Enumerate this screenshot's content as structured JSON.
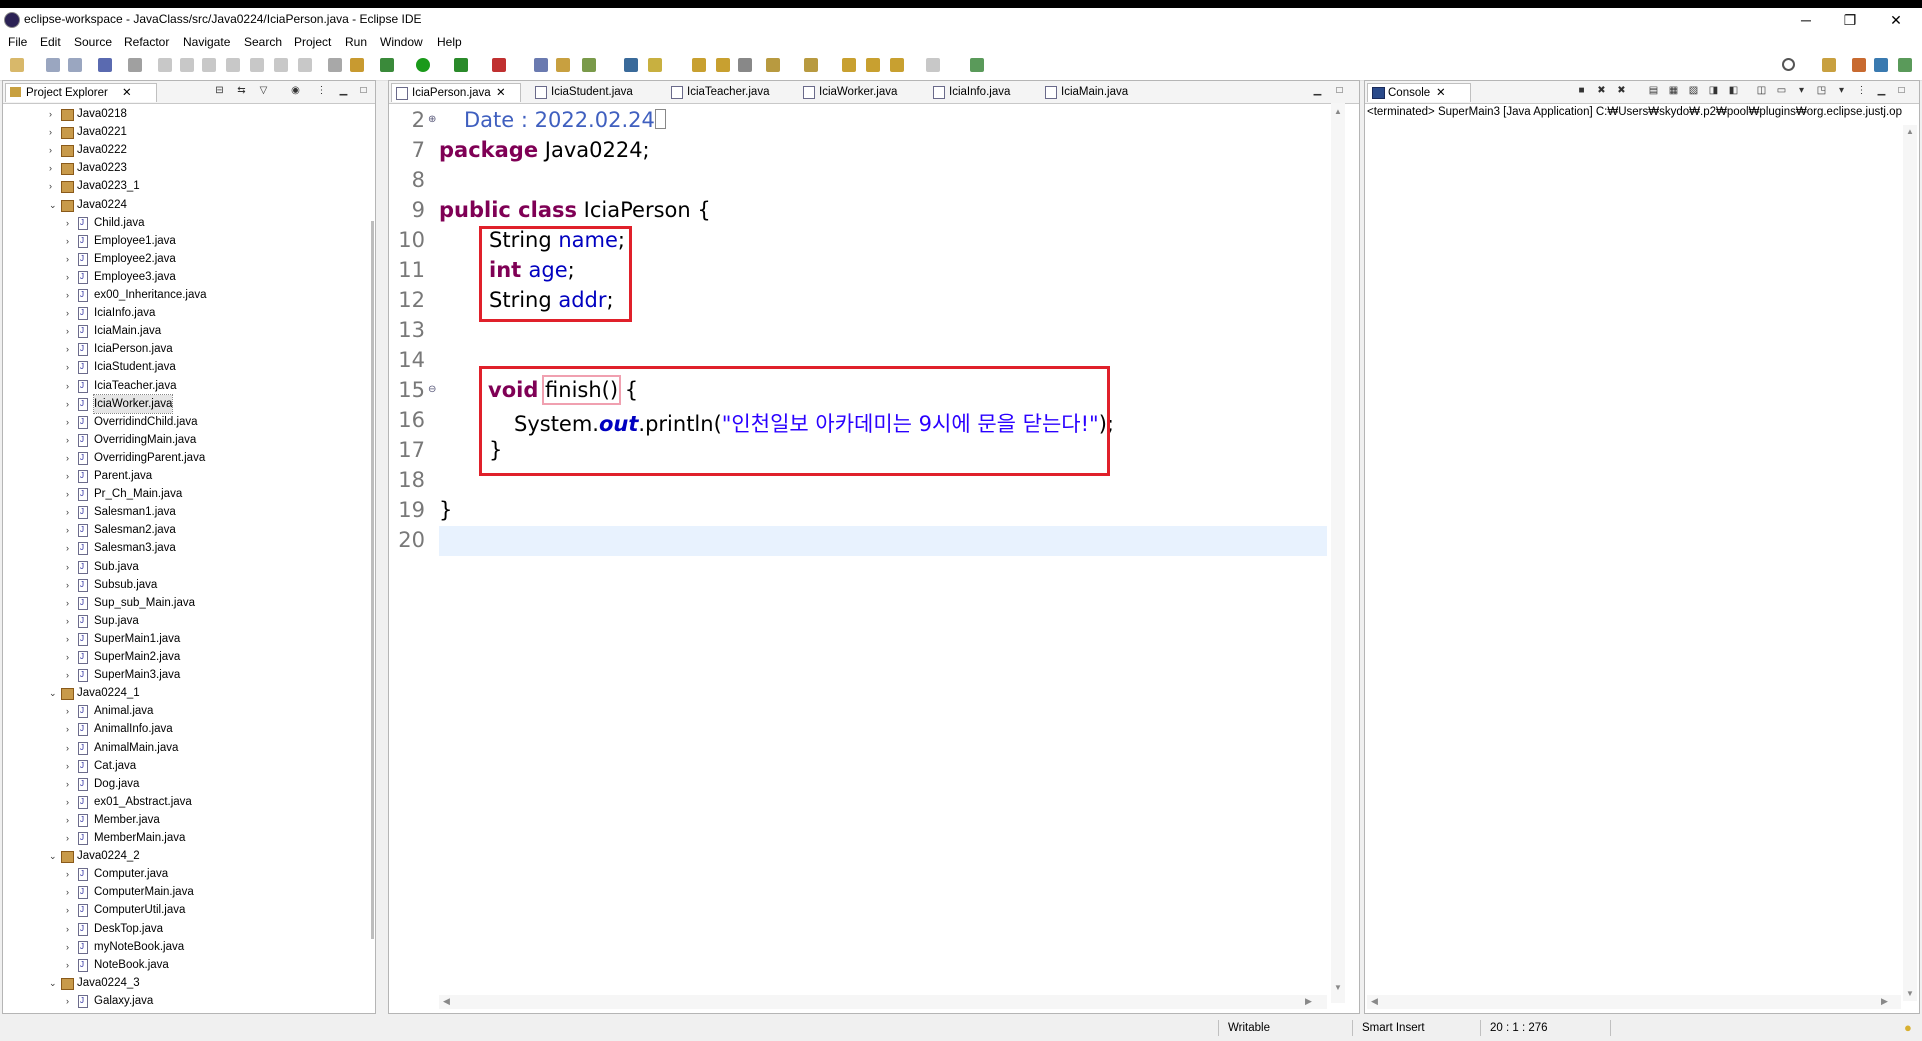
{
  "window": {
    "title": "eclipse-workspace - JavaClass/src/Java0224/IciaPerson.java - Eclipse IDE",
    "minimize": "─",
    "maximize": "❐",
    "close": "✕"
  },
  "menu": [
    "File",
    "Edit",
    "Source",
    "Refactor",
    "Navigate",
    "Search",
    "Project",
    "Run",
    "Window",
    "Help"
  ],
  "project_explorer": {
    "title": "Project Explorer",
    "items": [
      {
        "label": "Java0218",
        "type": "pkg",
        "arrow": "›",
        "indent": 0
      },
      {
        "label": "Java0221",
        "type": "pkg",
        "arrow": "›",
        "indent": 0
      },
      {
        "label": "Java0222",
        "type": "pkg",
        "arrow": "›",
        "indent": 0
      },
      {
        "label": "Java0223",
        "type": "pkg",
        "arrow": "›",
        "indent": 0
      },
      {
        "label": "Java0223_1",
        "type": "pkg",
        "arrow": "›",
        "indent": 0
      },
      {
        "label": "Java0224",
        "type": "pkg",
        "arrow": "⌄",
        "indent": 0
      },
      {
        "label": "Child.java",
        "type": "file",
        "arrow": "›",
        "indent": 1
      },
      {
        "label": "Employee1.java",
        "type": "file",
        "arrow": "›",
        "indent": 1
      },
      {
        "label": "Employee2.java",
        "type": "file",
        "arrow": "›",
        "indent": 1
      },
      {
        "label": "Employee3.java",
        "type": "file",
        "arrow": "›",
        "indent": 1
      },
      {
        "label": "ex00_Inheritance.java",
        "type": "file",
        "arrow": "›",
        "indent": 1
      },
      {
        "label": "IciaInfo.java",
        "type": "file",
        "arrow": "›",
        "indent": 1
      },
      {
        "label": "IciaMain.java",
        "type": "file",
        "arrow": "›",
        "indent": 1
      },
      {
        "label": "IciaPerson.java",
        "type": "file",
        "arrow": "›",
        "indent": 1
      },
      {
        "label": "IciaStudent.java",
        "type": "file",
        "arrow": "›",
        "indent": 1
      },
      {
        "label": "IciaTeacher.java",
        "type": "file",
        "arrow": "›",
        "indent": 1
      },
      {
        "label": "IciaWorker.java",
        "type": "file",
        "arrow": "›",
        "indent": 1,
        "selected": true
      },
      {
        "label": "OverridindChild.java",
        "type": "file",
        "arrow": "›",
        "indent": 1
      },
      {
        "label": "OverridingMain.java",
        "type": "file",
        "arrow": "›",
        "indent": 1
      },
      {
        "label": "OverridingParent.java",
        "type": "file",
        "arrow": "›",
        "indent": 1
      },
      {
        "label": "Parent.java",
        "type": "file",
        "arrow": "›",
        "indent": 1
      },
      {
        "label": "Pr_Ch_Main.java",
        "type": "file",
        "arrow": "›",
        "indent": 1
      },
      {
        "label": "Salesman1.java",
        "type": "file",
        "arrow": "›",
        "indent": 1
      },
      {
        "label": "Salesman2.java",
        "type": "file",
        "arrow": "›",
        "indent": 1
      },
      {
        "label": "Salesman3.java",
        "type": "file",
        "arrow": "›",
        "indent": 1
      },
      {
        "label": "Sub.java",
        "type": "file",
        "arrow": "›",
        "indent": 1
      },
      {
        "label": "Subsub.java",
        "type": "file",
        "arrow": "›",
        "indent": 1
      },
      {
        "label": "Sup_sub_Main.java",
        "type": "file",
        "arrow": "›",
        "indent": 1
      },
      {
        "label": "Sup.java",
        "type": "file",
        "arrow": "›",
        "indent": 1
      },
      {
        "label": "SuperMain1.java",
        "type": "file",
        "arrow": "›",
        "indent": 1
      },
      {
        "label": "SuperMain2.java",
        "type": "file",
        "arrow": "›",
        "indent": 1
      },
      {
        "label": "SuperMain3.java",
        "type": "file",
        "arrow": "›",
        "indent": 1
      },
      {
        "label": "Java0224_1",
        "type": "pkg",
        "arrow": "⌄",
        "indent": 0
      },
      {
        "label": "Animal.java",
        "type": "file",
        "arrow": "›",
        "indent": 1
      },
      {
        "label": "AnimalInfo.java",
        "type": "file",
        "arrow": "›",
        "indent": 1
      },
      {
        "label": "AnimalMain.java",
        "type": "file",
        "arrow": "›",
        "indent": 1
      },
      {
        "label": "Cat.java",
        "type": "file",
        "arrow": "›",
        "indent": 1
      },
      {
        "label": "Dog.java",
        "type": "file",
        "arrow": "›",
        "indent": 1
      },
      {
        "label": "ex01_Abstract.java",
        "type": "file",
        "arrow": "›",
        "indent": 1
      },
      {
        "label": "Member.java",
        "type": "file",
        "arrow": "›",
        "indent": 1
      },
      {
        "label": "MemberMain.java",
        "type": "file",
        "arrow": "›",
        "indent": 1
      },
      {
        "label": "Java0224_2",
        "type": "pkg",
        "arrow": "⌄",
        "indent": 0
      },
      {
        "label": "Computer.java",
        "type": "file",
        "arrow": "›",
        "indent": 1
      },
      {
        "label": "ComputerMain.java",
        "type": "file",
        "arrow": "›",
        "indent": 1
      },
      {
        "label": "ComputerUtil.java",
        "type": "file",
        "arrow": "›",
        "indent": 1
      },
      {
        "label": "DeskTop.java",
        "type": "file",
        "arrow": "›",
        "indent": 1
      },
      {
        "label": "myNoteBook.java",
        "type": "file",
        "arrow": "›",
        "indent": 1
      },
      {
        "label": "NoteBook.java",
        "type": "file",
        "arrow": "›",
        "indent": 1
      },
      {
        "label": "Java0224_3",
        "type": "pkg",
        "arrow": "⌄",
        "indent": 0
      },
      {
        "label": "Galaxy.java",
        "type": "file",
        "arrow": "›",
        "indent": 1
      }
    ]
  },
  "editor": {
    "tabs": [
      "IciaPerson.java",
      "IciaStudent.java",
      "IciaTeacher.java",
      "IciaWorker.java",
      "IciaInfo.java",
      "IciaMain.java"
    ],
    "active_tab": "IciaPerson.java",
    "line_numbers": [
      "2",
      "7",
      "8",
      "9",
      "10",
      "11",
      "12",
      "13",
      "14",
      "15",
      "16",
      "17",
      "18",
      "19",
      "20"
    ],
    "code": {
      "l2": "Date : 2022.02.24",
      "l7_kw": "package",
      "l7_rest": " Java0224;",
      "l9_kw": "public class",
      "l9_rest": " IciaPerson {",
      "l10_type": "String ",
      "l10_field": "name",
      "l10_end": ";",
      "l11_kw": "int ",
      "l11_field": "age",
      "l11_end": ";",
      "l12_type": "String ",
      "l12_field": "addr",
      "l12_end": ";",
      "l15_kw": "void",
      "l15_method": "finish()",
      "l15_end": " {",
      "l16_a": "System.",
      "l16_out": "out",
      "l16_b": ".println(",
      "l16_str": "\"인천일보 아카데미는 9시에 문을 닫는다!\"",
      "l16_end": ");",
      "l17": "}",
      "l19": "}"
    }
  },
  "console": {
    "title": "Console",
    "text": "<terminated> SuperMain3 [Java Application] C:₩Users₩skydo₩.p2₩pool₩plugins₩org.eclipse.justj.op"
  },
  "status": {
    "writable": "Writable",
    "insert_mode": "Smart Insert",
    "position": "20 : 1 : 276"
  }
}
